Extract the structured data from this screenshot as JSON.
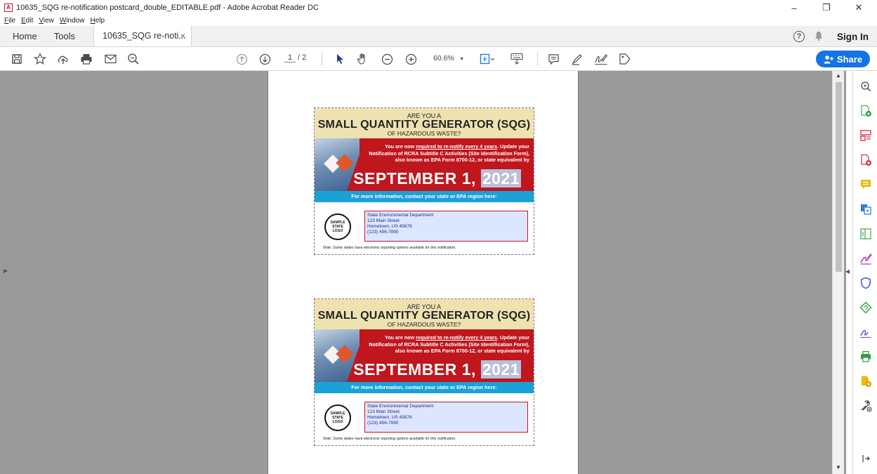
{
  "window": {
    "title": "10635_SQG re-notification postcard_double_EDITABLE.pdf - Adobe Acrobat Reader DC",
    "app_icon": "acrobat-icon",
    "minimize": "–",
    "restore": "❐",
    "close": "✕"
  },
  "menu": [
    "File",
    "Edit",
    "View",
    "Window",
    "Help"
  ],
  "tabs": {
    "home": "Home",
    "tools": "Tools",
    "doc": "10635_SQG re-noti...",
    "close": "×",
    "help": "?",
    "signin": "Sign In"
  },
  "toolbar": {
    "page_current": "1",
    "page_total": "/ 2",
    "zoom": "60.6%",
    "share": "Share"
  },
  "postcard": {
    "line1": "ARE YOU A",
    "line2": "SMALL QUANTITY GENERATOR (SQG)",
    "line3": "OF HAZARDOUS WASTE?",
    "body_pre": "You are now ",
    "body_emph": "required to re-notify every 4 years",
    "body_post": ". Update your Notification of RCRA Subtitle C Activities (Site Identification Form), also known as EPA Form 8700-12, or state equivalent by",
    "date_main": "SEPTEMBER 1, ",
    "date_year": "2021",
    "info": "For more information, contact your state or EPA region here:",
    "logo_l1": "SAMPLE",
    "logo_l2": "STATE",
    "logo_l3": "LOGO",
    "addr1": "State Environmental Department",
    "addr2": "123 Main Street",
    "addr3": "Hometown, US 45678",
    "addr4": "(123) 456-7890",
    "note": "Note: Some states have electronic reporting options available for this notification."
  },
  "colors": {
    "accent": "#1473e6",
    "banner_red": "#c0161d",
    "info_blue": "#1aa1d8",
    "header_tan": "#efe2b1"
  }
}
